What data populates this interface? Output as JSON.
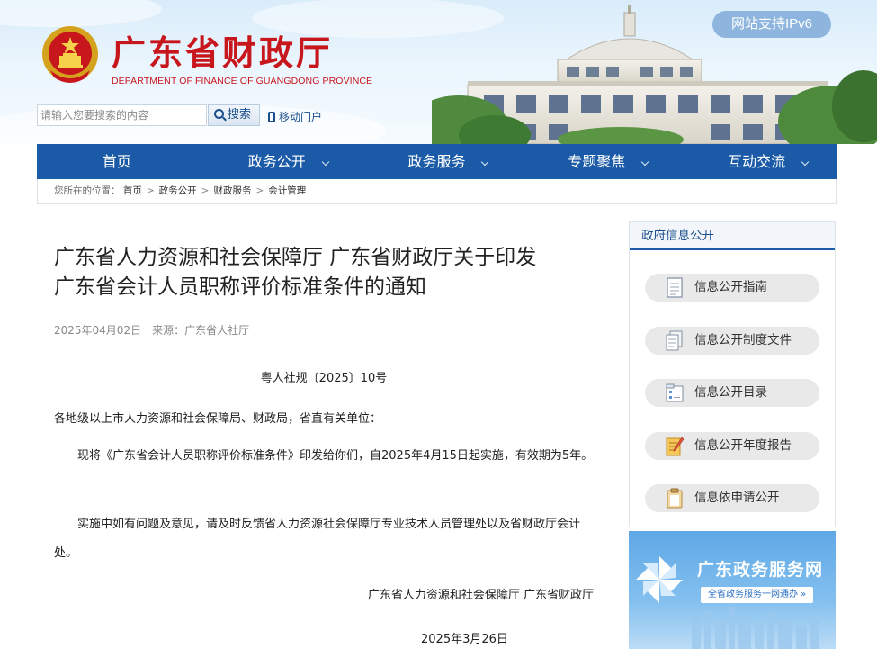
{
  "header": {
    "site_title": "广东省财政厅",
    "site_subtitle": "DEPARTMENT OF FINANCE OF GUANGDONG PROVINCE",
    "ipv6_badge": "网站支持IPv6",
    "search_placeholder": "请输入您要搜索的内容",
    "search_button": "搜索",
    "mobile_link": "移动门户"
  },
  "nav": {
    "items": [
      {
        "label": "首页",
        "has_dropdown": false
      },
      {
        "label": "政务公开",
        "has_dropdown": true
      },
      {
        "label": "政务服务",
        "has_dropdown": true
      },
      {
        "label": "专题聚焦",
        "has_dropdown": true
      },
      {
        "label": "互动交流",
        "has_dropdown": true
      }
    ]
  },
  "breadcrumb": {
    "prefix": "您所在的位置：",
    "items": [
      "首页",
      "政务公开",
      "财政服务",
      "会计管理"
    ],
    "separator": ">"
  },
  "article": {
    "title_line1": "广东省人力资源和社会保障厅 广东省财政厅关于印发",
    "title_line2": "广东省会计人员职称评价标准条件的通知",
    "date": "2025年04月02日",
    "source": "来源：广东省人社厅",
    "doc_number": "粤人社规〔2025〕10号",
    "paragraph1": "各地级以上市人力资源和社会保障局、财政局，省直有关单位：",
    "paragraph2": "现将《广东省会计人员职称评价标准条件》印发给你们，自2025年4月15日起实施，有效期为5年。",
    "paragraph3": "实施中如有问题及意见，请及时反馈省人力资源社会保障厅专业技术人员管理处以及省财政厅会计处。",
    "signature": "广东省人力资源和社会保障厅 广东省财政厅",
    "sign_date": "2025年3月26日"
  },
  "sidebar": {
    "heading": "政府信息公开",
    "buttons": [
      {
        "label": "信息公开指南",
        "icon": "document-icon"
      },
      {
        "label": "信息公开制度文件",
        "icon": "files-icon"
      },
      {
        "label": "信息公开目录",
        "icon": "folder-list-icon"
      },
      {
        "label": "信息公开年度报告",
        "icon": "report-pencil-icon"
      },
      {
        "label": "信息依申请公开",
        "icon": "clipboard-icon"
      }
    ],
    "service_banner": {
      "title": "广东政务服务网",
      "subtitle": "全省政务服务一网通办 »"
    }
  },
  "colors": {
    "brand_red": "#c8161d",
    "nav_blue": "#1a5aa6",
    "link_blue": "#1a4d8c",
    "ipv6_badge": "#8db5de"
  }
}
